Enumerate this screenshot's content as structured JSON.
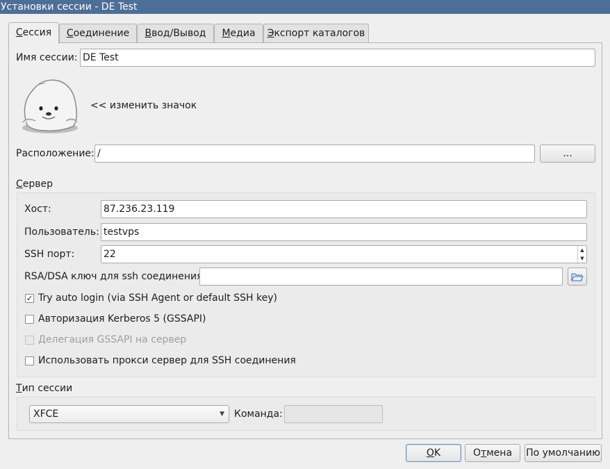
{
  "window": {
    "title": "Установки сессии - DE Test"
  },
  "tabs": [
    {
      "label": "Сессия",
      "mnemonic": "С",
      "rest": "ессия",
      "active": true
    },
    {
      "label": "Соединение",
      "mnemonic": "С",
      "rest": "оединение",
      "active": false
    },
    {
      "label": "Ввод/Вывод",
      "mnemonic": "В",
      "rest": "вод/Вывод",
      "active": false
    },
    {
      "label": "Медиа",
      "mnemonic": "М",
      "rest": "едиа",
      "active": false
    },
    {
      "label": "Экспорт каталогов",
      "mnemonic": "Э",
      "rest": "кспорт каталогов",
      "active": false
    }
  ],
  "session": {
    "name_label": "Имя сессии:",
    "name_value": "DE Test",
    "change_icon_label": "<< изменить значок",
    "location_label": "Расположение:",
    "location_value": "/",
    "browse_label": "..."
  },
  "server": {
    "group_mnemonic": "С",
    "group_rest": "ервер",
    "host_label": "Хост:",
    "host_value": "87.236.23.119",
    "user_label": "Пользователь:",
    "user_value": "testvps",
    "port_label": "SSH порт:",
    "port_value": "22",
    "key_label": "RSA/DSA ключ для ssh соединения:",
    "key_value": "",
    "auto_login_label": "Try auto login (via SSH Agent or default SSH key)",
    "auto_login_checked": true,
    "kerberos_label": "Авторизация Kerberos 5 (GSSAPI)",
    "kerberos_checked": false,
    "delegation_label": "Делегация GSSAPI на сервер",
    "delegation_checked": false,
    "proxy_label": "Использовать прокси сервер для SSH соединения",
    "proxy_checked": false
  },
  "session_type": {
    "group_mnemonic": "Т",
    "group_rest": "ип сессии",
    "selected": "XFCE",
    "command_label": "Команда:",
    "command_value": ""
  },
  "buttons": {
    "ok_mnemonic": "O",
    "ok_rest": "K",
    "cancel_pre": "О",
    "cancel_mnemonic": "т",
    "cancel_rest": "мена",
    "defaults": "По умолчанию"
  },
  "icons": {
    "seal": "seal-mascot-icon",
    "check": "✓",
    "folder": "folder-open-icon"
  }
}
